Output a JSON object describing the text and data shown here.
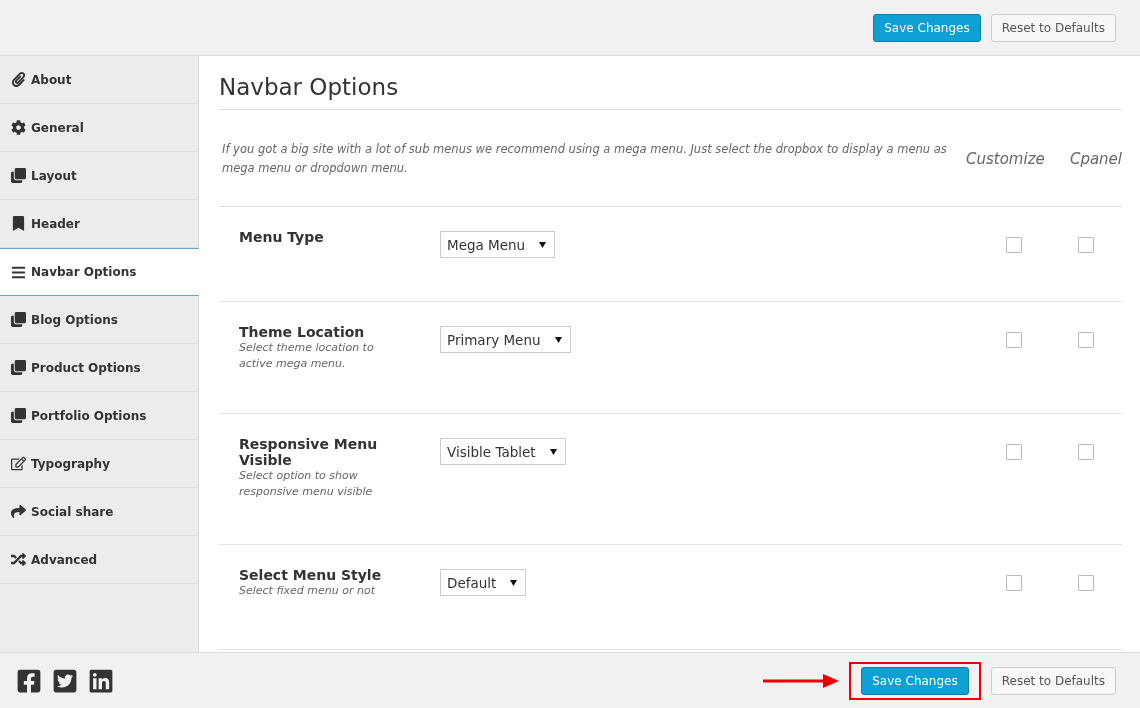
{
  "top_bar": {
    "save_button": "Save Changes",
    "reset_button": "Reset to Defaults"
  },
  "sidebar": {
    "items": [
      {
        "label": "About",
        "selected": false
      },
      {
        "label": "General",
        "selected": false
      },
      {
        "label": "Layout",
        "selected": false
      },
      {
        "label": "Header",
        "selected": false
      },
      {
        "label": "Navbar Options",
        "selected": true
      },
      {
        "label": "Blog Options",
        "selected": false
      },
      {
        "label": "Product Options",
        "selected": false
      },
      {
        "label": "Portfolio Options",
        "selected": false
      },
      {
        "label": "Typography",
        "selected": false
      },
      {
        "label": "Social share",
        "selected": false
      },
      {
        "label": "Advanced",
        "selected": false
      }
    ]
  },
  "content": {
    "title": "Navbar Options",
    "intro": "If you got a big site with a lot of sub menus we recommend using a mega menu. Just select the dropbox to display a menu as mega menu or dropdown menu.",
    "columns": [
      "Customize",
      "Cpanel"
    ],
    "options": [
      {
        "label": "Menu Type",
        "value": "Mega Menu",
        "customize": false,
        "cpanel": false
      },
      {
        "label": "Theme Location",
        "description": "Select theme location to active mega menu.",
        "value": "Primary Menu",
        "customize": false,
        "cpanel": false
      },
      {
        "label": "Responsive Menu Visible",
        "description": "Select option to show responsive menu visible",
        "value": "Visible Tablet",
        "customize": false,
        "cpanel": false
      },
      {
        "label": "Select Menu Style",
        "description": "Select fixed menu or not",
        "value": "Default",
        "customize": false,
        "cpanel": false
      }
    ]
  },
  "footer": {
    "save_button": "Save Changes",
    "reset_button": "Reset to Defaults"
  }
}
